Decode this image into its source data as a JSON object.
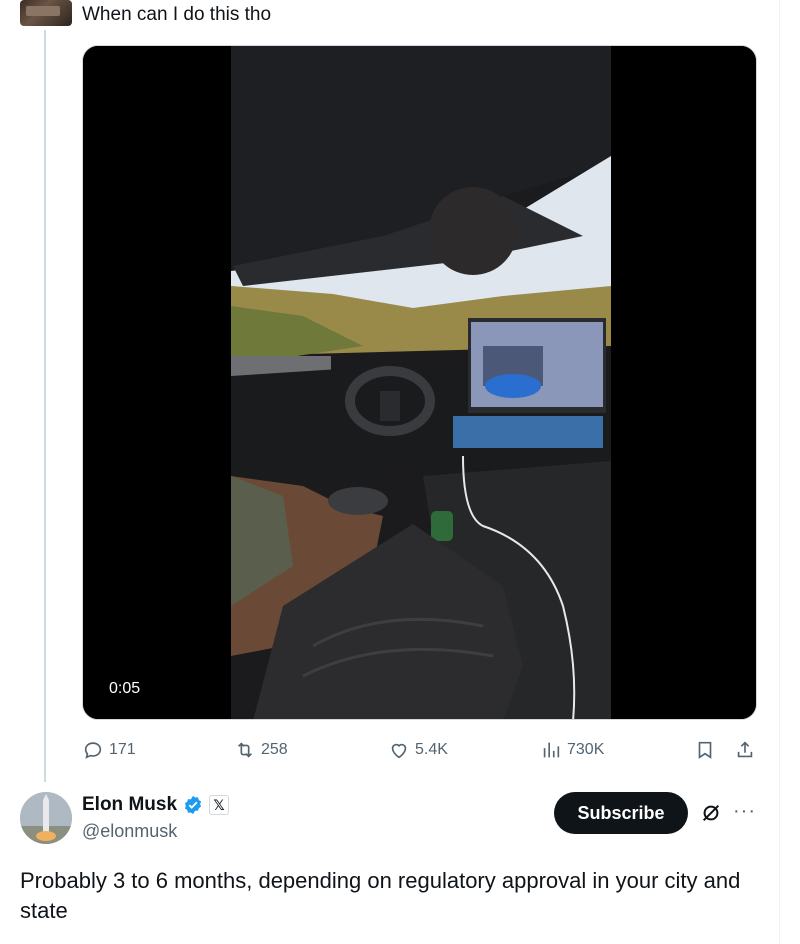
{
  "tweet": {
    "text": "When can I do this tho",
    "video": {
      "timecode": "0:05"
    },
    "stats": {
      "replies": "171",
      "reposts": "258",
      "likes": "5.4K",
      "views": "730K"
    },
    "icons": [
      "reply-icon",
      "repost-icon",
      "like-icon",
      "views-icon",
      "bookmark-icon",
      "share-icon"
    ]
  },
  "reply": {
    "display_name": "Elon Musk",
    "handle": "@elonmusk",
    "affiliate_badge": "𝕏",
    "subscribe_label": "Subscribe",
    "more_label": "···",
    "text": "Probably 3 to 6 months, depending on regulatory approval in your city and state"
  },
  "colors": {
    "text_primary": "#0f1419",
    "text_secondary": "#536471",
    "verified_blue": "#1d9bf0",
    "border": "#cfd9de"
  }
}
